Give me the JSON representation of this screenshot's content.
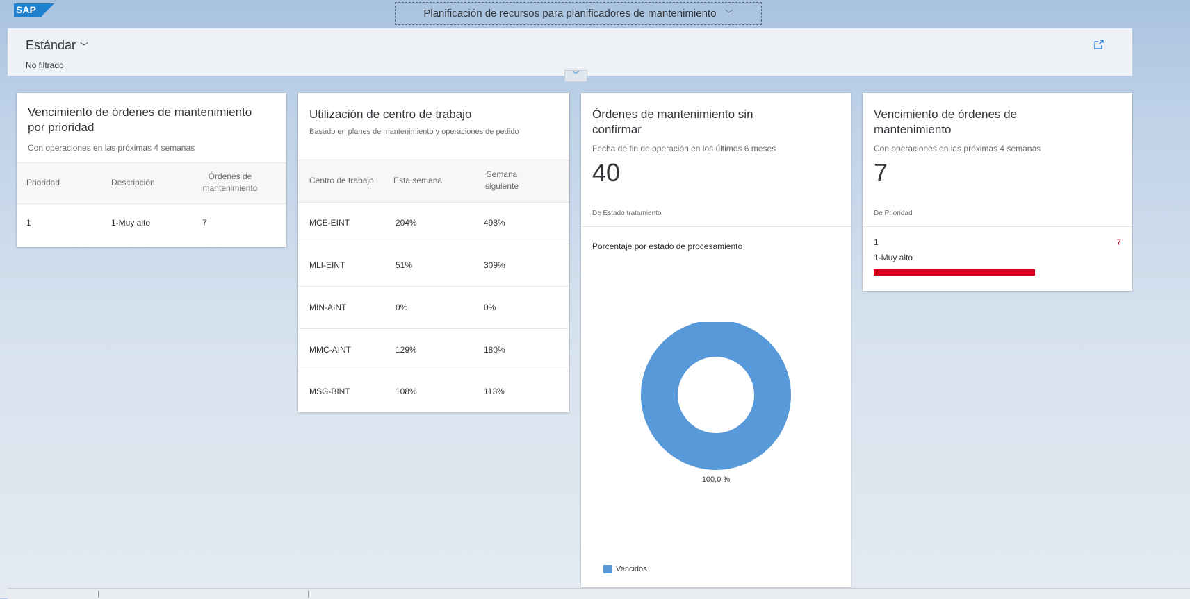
{
  "shell": {
    "logo_text": "SAP",
    "app_title": "Planificación de recursos para planificadores de mantenimiento",
    "app_title_icon": "chevron-down-icon"
  },
  "filter_bar": {
    "variant": "Estándar",
    "filter_state": "No filtrado",
    "share_icon": "share-icon",
    "collapse_icon": "chevron-down-icon"
  },
  "cards": {
    "priority_table": {
      "title": "Vencimiento de órdenes de mantenimiento por prioridad",
      "subtitle": "Con operaciones en las próximas 4 semanas",
      "columns": [
        "Prioridad",
        "Descripción",
        "Órdenes de mantenimiento"
      ],
      "rows": [
        [
          "1",
          "1-Muy alto",
          "7"
        ]
      ]
    },
    "work_center": {
      "title": "Utilización de centro de trabajo",
      "subtitle": "Basado en planes de mantenimiento y operaciones de pedido",
      "columns": [
        "Centro de trabajo",
        "Esta semana",
        "Semana siguiente"
      ],
      "rows": [
        [
          "MCE-EINT",
          "204%",
          "498%"
        ],
        [
          "MLI-EINT",
          "51%",
          "309%"
        ],
        [
          "MIN-AINT",
          "0%",
          "0%"
        ],
        [
          "MMC-AINT",
          "129%",
          "180%"
        ],
        [
          "MSG-BINT",
          "108%",
          "113%"
        ]
      ]
    },
    "unconfirmed": {
      "title": "Órdenes de mantenimiento sin confirmar",
      "subtitle": "Fecha de fin de operación en los últimos 6 meses",
      "kpi": "40",
      "kpi_footer": "De Estado tratamiento",
      "chart_title": "Porcentaje por estado de procesamiento",
      "color": "#5899da"
    },
    "due_orders": {
      "title": "Vencimiento de órdenes de mantenimiento",
      "subtitle": "Con operaciones en las próximas 4 semanas",
      "kpi": "7",
      "kpi_footer": "De Prioridad",
      "bar_item": {
        "label_top": "1",
        "label_bottom": "1-Muy alto",
        "value": "7",
        "value_color": "#d0021b",
        "bar_color": "#d0021b",
        "fill_fraction": 1.0
      }
    }
  },
  "chart_data": {
    "type": "pie",
    "donut": true,
    "categories": [
      "Vencidos"
    ],
    "values": [
      100.0
    ],
    "data_labels": [
      "100,0 %"
    ],
    "colors": [
      "#5899da"
    ],
    "legend": [
      "Vencidos"
    ],
    "legend_placement": "bottom-left"
  }
}
